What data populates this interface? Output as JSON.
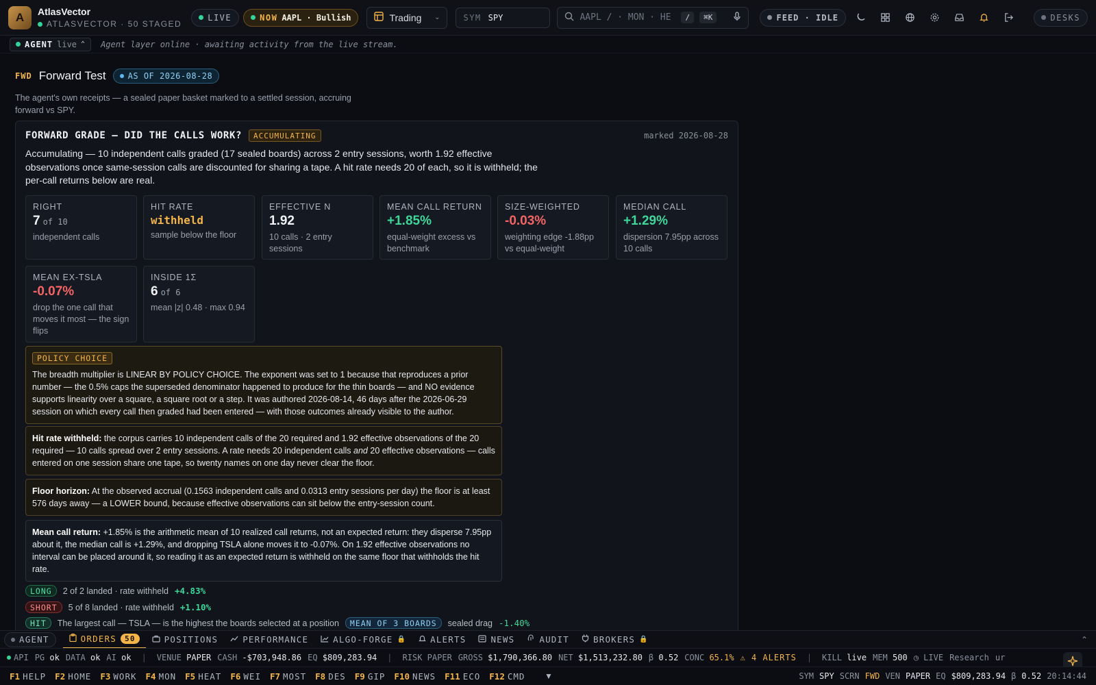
{
  "app": {
    "name": "AtlasVector",
    "subtitle": "ATLASVECTOR · 50 STAGED",
    "logo_letter": "A",
    "live": "LIVE",
    "now_label": "NOW",
    "now_value": "AAPL · Bullish",
    "workspace": "Trading",
    "sym_label": "SYM",
    "sym_value": "SPY",
    "search_placeholder": "AAPL / · MON · HE",
    "search_slash": "/",
    "search_shortcut": "⌘K",
    "feed": "FEED · IDLE",
    "desks": "DESKS",
    "icons": [
      "moon-icon",
      "grid-icon",
      "globe-icon",
      "gear-icon",
      "inbox-icon",
      "bell-icon",
      "logout-icon",
      "mic-icon",
      "search-icon"
    ]
  },
  "agent": {
    "label": "AGENT",
    "status": "live",
    "message": "Agent layer online · awaiting activity from the live stream."
  },
  "page": {
    "tag": "FWD",
    "title": "Forward Test",
    "as_of": "AS OF 2026-08-28",
    "description": "The agent's own receipts — a sealed paper basket marked to a settled session, accruing forward vs SPY."
  },
  "grade": {
    "title": "FORWARD GRADE — DID THE CALLS WORK?",
    "status": "ACCUMULATING",
    "marked": "marked 2026-08-28",
    "summary": "Accumulating — 10 independent calls graded (17 sealed boards) across 2 entry sessions, worth 1.92 effective observations once same-session calls are discounted for sharing a tape. A hit rate needs 20 of each, so it is withheld; the per-call returns below are real.",
    "stats": [
      {
        "label": "RIGHT",
        "value": "7",
        "of": "of 10",
        "sub": "independent calls"
      },
      {
        "label": "HIT RATE",
        "value": "withheld",
        "of": "",
        "sub": "sample below the floor"
      },
      {
        "label": "EFFECTIVE N",
        "value": "1.92",
        "of": "",
        "sub": "10 calls · 2 entry sessions"
      },
      {
        "label": "MEAN CALL RETURN",
        "value": "+1.85%",
        "of": "",
        "sub": "equal-weight excess vs benchmark"
      },
      {
        "label": "SIZE-WEIGHTED",
        "value": "-0.03%",
        "of": "",
        "sub": "weighting edge -1.88pp vs equal-weight"
      },
      {
        "label": "MEDIAN CALL",
        "value": "+1.29%",
        "of": "",
        "sub": "dispersion 7.95pp across 10 calls"
      },
      {
        "label": "MEAN EX-TSLA",
        "value": "-0.07%",
        "of": "",
        "sub": "drop the one call that moves it most — the sign flips"
      },
      {
        "label": "INSIDE 1Σ",
        "value": "6",
        "of": "of 6",
        "sub": "mean |z| 0.48 · max 0.94"
      }
    ],
    "policy_tag": "POLICY CHOICE",
    "policy_text": "The breadth multiplier is LINEAR BY POLICY CHOICE. The exponent was set to 1 because that reproduces a prior number — the 0.5% caps the superseded denominator happened to produce for the thin boards — and NO evidence supports linearity over a square, a square root or a step. It was authored 2026-08-14, 46 days after the 2026-06-29 session on which every call then graded had been entered — with those outcomes already visible to the author.",
    "hit_label": "Hit rate withheld:",
    "hit_text_1": " the corpus carries 10 independent calls of the 20 required and 1.92 effective observations of the 20 required — 10 calls spread over 2 entry sessions. A rate needs 20 independent calls ",
    "hit_and": "and",
    "hit_text_2": " 20 effective observations — calls entered on one session share one tape, so twenty names on one day never clear the floor.",
    "floor_label": "Floor horizon:",
    "floor_text": " At the observed accrual (0.1563 independent calls and 0.0313 entry sessions per day) the floor is at least 576 days away — a LOWER bound, because effective observations can sit below the entry-session count.",
    "mean_label": "Mean call return:",
    "mean_text": " +1.85% is the arithmetic mean of 10 realized call returns, not an expected return: they disperse 7.95pp about it, the median call is +1.29%, and dropping TSLA alone moves it to -0.07%. On 1.92 effective observations no interval can be placed around it, so reading it as an expected return is withheld on the same floor that withholds the hit rate.",
    "sides": [
      {
        "tag": "LONG",
        "text": "2 of 2 landed · rate withheld",
        "ret": "+4.83%"
      },
      {
        "tag": "SHORT",
        "text": "5 of 8 landed · rate withheld",
        "ret": "+1.10%"
      }
    ],
    "partial_row": {
      "tag": "HIT",
      "text": "The largest call — TSLA — is the highest the boards selected at a position",
      "chip": "MEAN OF 3 BOARDS",
      "tail": "sealed drag",
      "ret": "-1.40%"
    }
  },
  "tabs": {
    "agent": "AGENT",
    "items": [
      {
        "label": "ORDERS",
        "badge": "50",
        "icon": "clipboard-icon"
      },
      {
        "label": "POSITIONS",
        "icon": "briefcase-icon"
      },
      {
        "label": "PERFORMANCE",
        "icon": "chart-line-icon"
      },
      {
        "label": "ALGO-FORGE",
        "icon": "chart-area-icon",
        "locked": "🔒"
      },
      {
        "label": "ALERTS",
        "icon": "bell-icon"
      },
      {
        "label": "NEWS",
        "icon": "newspaper-icon"
      },
      {
        "label": "AUDIT",
        "icon": "fingerprint-icon"
      },
      {
        "label": "BROKERS",
        "icon": "plug-icon",
        "locked": "🔒"
      }
    ]
  },
  "status": {
    "api": "API",
    "pg": "PG",
    "pg_v": "ok",
    "data": "DATA",
    "data_v": "ok",
    "ai": "AI",
    "ai_v": "ok",
    "venue": "VENUE",
    "venue_v": "PAPER",
    "cash": "CASH",
    "cash_v": "-$703,948.86",
    "eq": "EQ",
    "eq_v": "$809,283.94",
    "risk": "RISK",
    "risk_v": "PAPER",
    "gross": "GROSS",
    "gross_v": "$1,790,366.80",
    "net": "NET",
    "net_v": "$1,513,232.80",
    "beta": "β",
    "beta_v": "0.52",
    "conc": "CONC",
    "conc_v": "65.1%",
    "alerts": "⚠ 4 ALERTS",
    "kill": "KILL",
    "kill_v": "live",
    "mem": "MEM",
    "mem_v": "500",
    "live": "LIVE",
    "research": "Research",
    "trail": "ur"
  },
  "fkeys": [
    {
      "k": "F1",
      "l": "HELP"
    },
    {
      "k": "F2",
      "l": "HOME"
    },
    {
      "k": "F3",
      "l": "WORK"
    },
    {
      "k": "F4",
      "l": "MON"
    },
    {
      "k": "F5",
      "l": "HEAT"
    },
    {
      "k": "F6",
      "l": "WEI"
    },
    {
      "k": "F7",
      "l": "MOST"
    },
    {
      "k": "F8",
      "l": "DES"
    },
    {
      "k": "F9",
      "l": "GIP"
    },
    {
      "k": "F10",
      "l": "NEWS"
    },
    {
      "k": "F11",
      "l": "ECO"
    },
    {
      "k": "F12",
      "l": "CMD"
    }
  ],
  "footer_right": {
    "sym": "SYM",
    "sym_v": "SPY",
    "scrn": "SCRN",
    "scrn_v": "FWD",
    "ven": "VEN",
    "ven_v": "PAPER",
    "eq": "EQ",
    "eq_v": "$809,283.94",
    "beta": "β",
    "beta_v": "0.52",
    "time": "20:14:44"
  },
  "colors": {
    "accent": "#f3b44a",
    "positive": "#3fd69a",
    "negative": "#f46464",
    "info": "#8fd0f5"
  }
}
